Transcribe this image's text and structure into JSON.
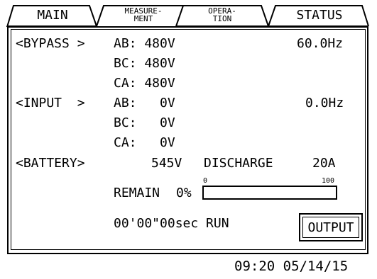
{
  "tabs": {
    "main": "MAIN",
    "measurement": [
      "MEASURE-",
      "MENT"
    ],
    "operation": [
      "OPERA-",
      "TION"
    ],
    "status": "STATUS"
  },
  "bypass": {
    "label": "<BYPASS >",
    "ab": "AB: 480V",
    "bc": "BC: 480V",
    "ca": "CA: 480V",
    "freq": "60.0Hz"
  },
  "input": {
    "label": "<INPUT  >",
    "ab": "AB:   0V",
    "bc": "BC:   0V",
    "ca": "CA:   0V",
    "freq": "0.0Hz"
  },
  "battery": {
    "label": "<BATTERY>",
    "voltage": "545V",
    "mode": "DISCHARGE",
    "current": "20A"
  },
  "remain": {
    "label": "REMAIN",
    "value": "0%",
    "scale_min": "0",
    "scale_max": "100",
    "level": 0
  },
  "runtime": "00'00\"00sec RUN",
  "output_button": "OUTPUT",
  "clock": "09:20 05/14/15"
}
